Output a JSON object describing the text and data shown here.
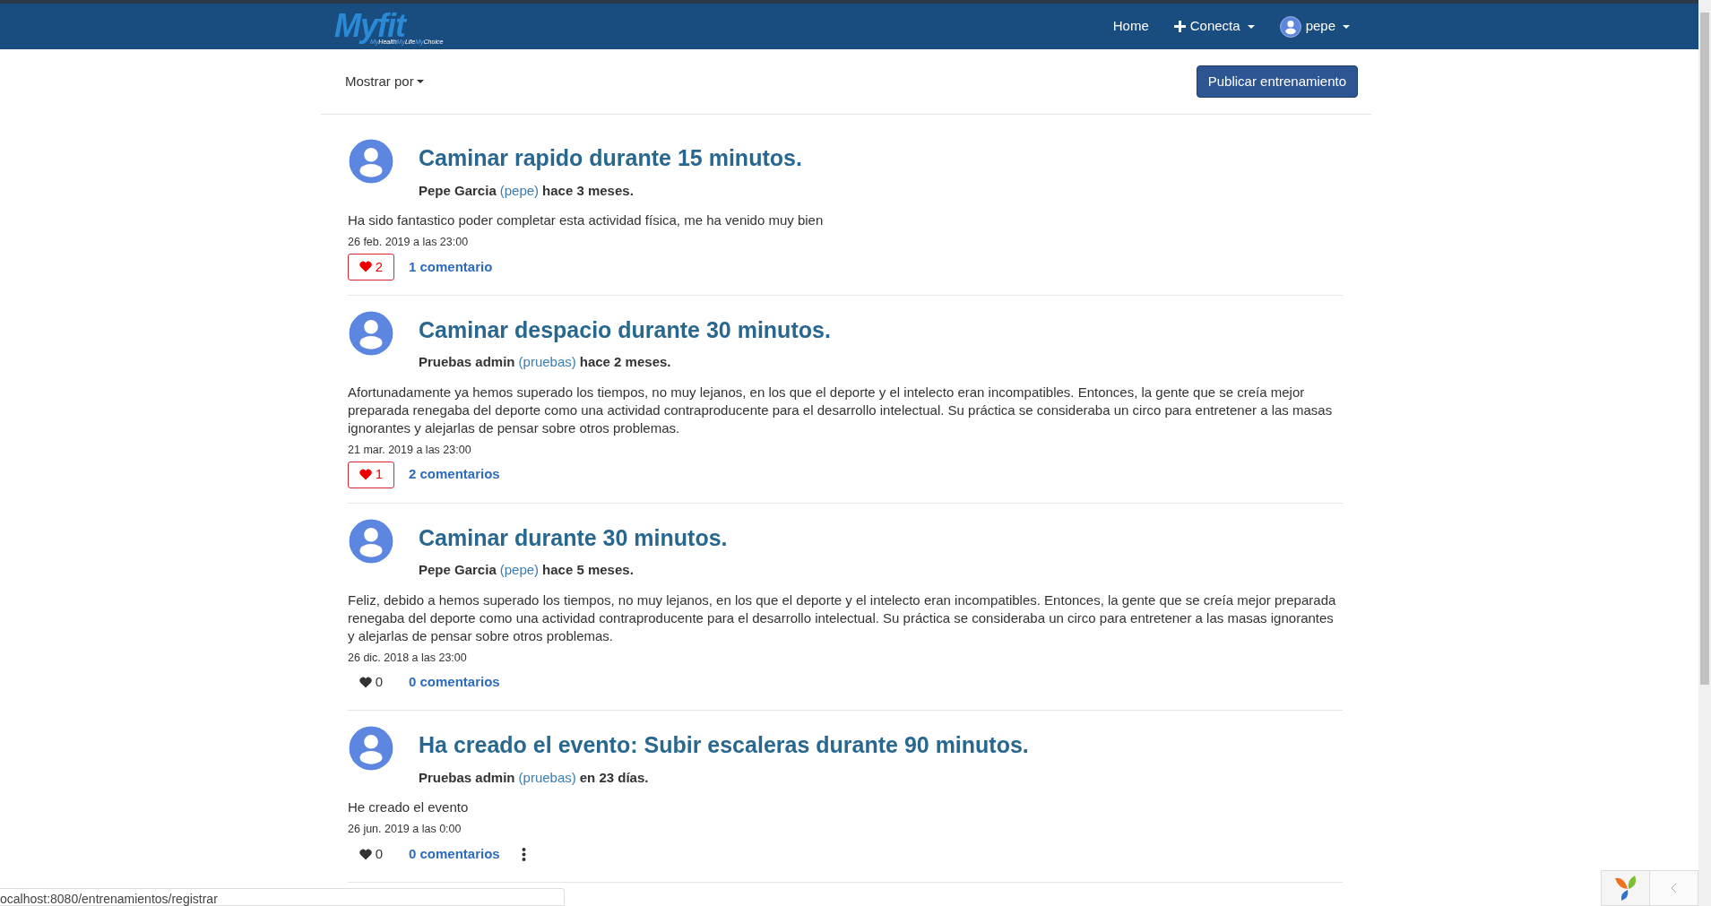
{
  "navbar": {
    "logo_text": "Myfit",
    "logo_tagline": [
      "My",
      "Health",
      "My",
      "Life",
      "My",
      "Choice"
    ],
    "links": [
      {
        "label": "Home",
        "kind": "plain"
      },
      {
        "label": "Conecta",
        "kind": "plus"
      },
      {
        "label": "pepe",
        "kind": "user"
      }
    ]
  },
  "toolbar": {
    "sort_label": "Mostrar por",
    "publish_button": "Publicar entrenamiento"
  },
  "posts": [
    {
      "title": "Caminar rapido durante 15 minutos.",
      "author": "Pepe Garcia",
      "username": "(pepe)",
      "time": "hace 3 meses.",
      "body": "Ha sido fantastico poder completar esta actividad física, me ha venido muy bien",
      "date": "26 feb. 2019 a las 23:00",
      "likes": "2",
      "liked": true,
      "comments": "1 comentario",
      "menu": false
    },
    {
      "title": "Caminar despacio durante 30 minutos.",
      "author": "Pruebas admin",
      "username": "(pruebas)",
      "time": "hace 2 meses.",
      "body": "Afortunadamente ya hemos superado los tiempos, no muy lejanos, en los que el deporte y el intelecto eran incompatibles. Entonces, la gente que se creía mejor preparada renegaba del deporte como una actividad contraproducente para el desarrollo intelectual. Su práctica se consideraba un circo para entretener a las masas ignorantes y alejarlas de pensar sobre otros problemas.",
      "date": "21 mar. 2019 a las 23:00",
      "likes": "1",
      "liked": true,
      "comments": "2 comentarios",
      "menu": false
    },
    {
      "title": "Caminar durante 30 minutos.",
      "author": "Pepe Garcia",
      "username": "(pepe)",
      "time": "hace 5 meses.",
      "body": "Feliz, debido a hemos superado los tiempos, no muy lejanos, en los que el deporte y el intelecto eran incompatibles. Entonces, la gente que se creía mejor preparada renegaba del deporte como una actividad contraproducente para el desarrollo intelectual. Su práctica se consideraba un circo para entretener a las masas ignorantes y alejarlas de pensar sobre otros problemas.",
      "date": "26 dic. 2018 a las 23:00",
      "likes": "0",
      "liked": false,
      "comments": "0 comentarios",
      "menu": false
    },
    {
      "title": "Ha creado el evento: Subir escaleras durante 90 minutos.",
      "author": "Pruebas admin",
      "username": "(pruebas)",
      "time": "en 23 días.",
      "body": "He creado el evento",
      "date": "26 jun. 2019 a las 0:00",
      "likes": "0",
      "liked": false,
      "comments": "0 comentarios",
      "menu": true
    }
  ],
  "status_bar": {
    "url": "ocalhost:8080/entrenamientos/registrar"
  }
}
